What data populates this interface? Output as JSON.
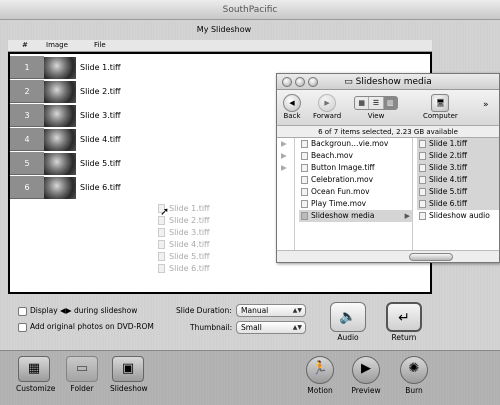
{
  "window": {
    "title": "SouthPacific"
  },
  "slideshow": {
    "name": "My Slideshow",
    "columns": [
      "#",
      "Image",
      "File"
    ],
    "slides": [
      {
        "num": "1",
        "file": "Slide 1.tiff"
      },
      {
        "num": "2",
        "file": "Slide 2.tiff"
      },
      {
        "num": "3",
        "file": "Slide 3.tiff"
      },
      {
        "num": "4",
        "file": "Slide 4.tiff"
      },
      {
        "num": "5",
        "file": "Slide 5.tiff"
      },
      {
        "num": "6",
        "file": "Slide 6.tiff"
      }
    ],
    "dragging": [
      "Slide 1.tiff",
      "Slide 2.tiff",
      "Slide 3.tiff",
      "Slide 4.tiff",
      "Slide 5.tiff",
      "Slide 6.tiff"
    ]
  },
  "controls": {
    "display_prefix": "Display",
    "display_suffix": "during slideshow",
    "arrows_glyph": "◀▶",
    "add_original": "Add original photos on DVD-ROM",
    "slide_duration_label": "Slide Duration:",
    "slide_duration_value": "Manual",
    "thumbnail_label": "Thumbnail:",
    "thumbnail_value": "Small",
    "audio_label": "Audio",
    "return_label": "Return"
  },
  "toolbar": {
    "customize": "Customize",
    "folder": "Folder",
    "slideshow": "Slideshow",
    "motion": "Motion",
    "preview": "Preview",
    "burn": "Burn"
  },
  "finder": {
    "title": "Slideshow media",
    "back": "Back",
    "forward": "Forward",
    "view": "View",
    "computer": "Computer",
    "status": "6 of 7 items selected, 2.23 GB available",
    "col1": [
      "Backgroun…vie.mov",
      "Beach.mov",
      "Button Image.tiff",
      "Celebration.mov",
      "Ocean Fun.mov",
      "Play Time.mov",
      "Slideshow media"
    ],
    "col2": [
      "Slide 1.tiff",
      "Slide 2.tiff",
      "Slide 3.tiff",
      "Slide 4.tiff",
      "Slide 5.tiff",
      "Slide 6.tiff",
      "Slideshow audio"
    ]
  }
}
